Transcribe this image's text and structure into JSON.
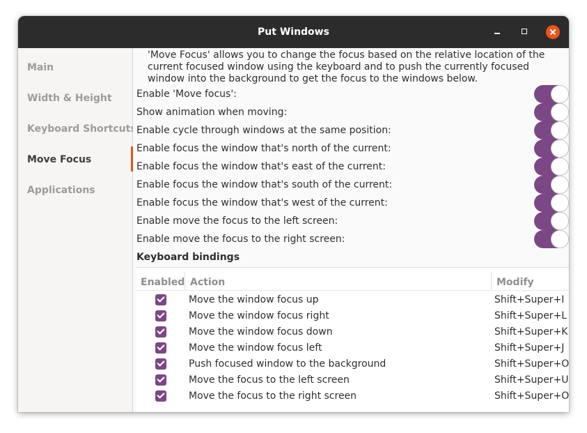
{
  "window": {
    "title": "Put Windows"
  },
  "sidebar": {
    "items": [
      {
        "label": "Main"
      },
      {
        "label": "Width & Height"
      },
      {
        "label": "Keyboard Shortcuts"
      },
      {
        "label": "Move Focus"
      },
      {
        "label": "Applications"
      }
    ],
    "active": "Move Focus"
  },
  "content": {
    "description": "'Move Focus' allows you to change the focus based on the relative location of the current focused window using the keyboard and to push the currently focused window into the background to get the focus to the windows below.",
    "options": [
      {
        "label": "Enable 'Move focus':",
        "enabled": true
      },
      {
        "label": "Show animation when moving:",
        "enabled": true
      },
      {
        "label": "Enable cycle through windows at the same position:",
        "enabled": true
      },
      {
        "label": "Enable focus the window that's north of the current:",
        "enabled": true
      },
      {
        "label": "Enable focus the window that's east of the current:",
        "enabled": true
      },
      {
        "label": "Enable focus the window that's south of the current:",
        "enabled": true
      },
      {
        "label": "Enable focus the window that's west of the current:",
        "enabled": true
      },
      {
        "label": "Enable move the focus to the left screen:",
        "enabled": true
      },
      {
        "label": "Enable move the focus to the right screen:",
        "enabled": true
      }
    ],
    "keyboard_bindings": {
      "title": "Keyboard bindings",
      "columns": {
        "enabled": "Enabled",
        "action": "Action",
        "modify": "Modify"
      },
      "rows": [
        {
          "enabled": true,
          "action": "Move the window focus up",
          "modify": "Shift+Super+I"
        },
        {
          "enabled": true,
          "action": "Move the window focus right",
          "modify": "Shift+Super+L"
        },
        {
          "enabled": true,
          "action": "Move the window focus down",
          "modify": "Shift+Super+K"
        },
        {
          "enabled": true,
          "action": "Move the window focus left",
          "modify": "Shift+Super+J"
        },
        {
          "enabled": true,
          "action": "Push focused window to the background",
          "modify": "Shift+Super+O"
        },
        {
          "enabled": true,
          "action": "Move the focus to the left screen",
          "modify": "Shift+Super+U"
        },
        {
          "enabled": true,
          "action": "Move the focus to the right screen",
          "modify": "Shift+Super+O"
        }
      ]
    }
  },
  "colors": {
    "accent": "#7b4885",
    "close": "#e9541f",
    "titlebar": "#2c2c2c"
  }
}
